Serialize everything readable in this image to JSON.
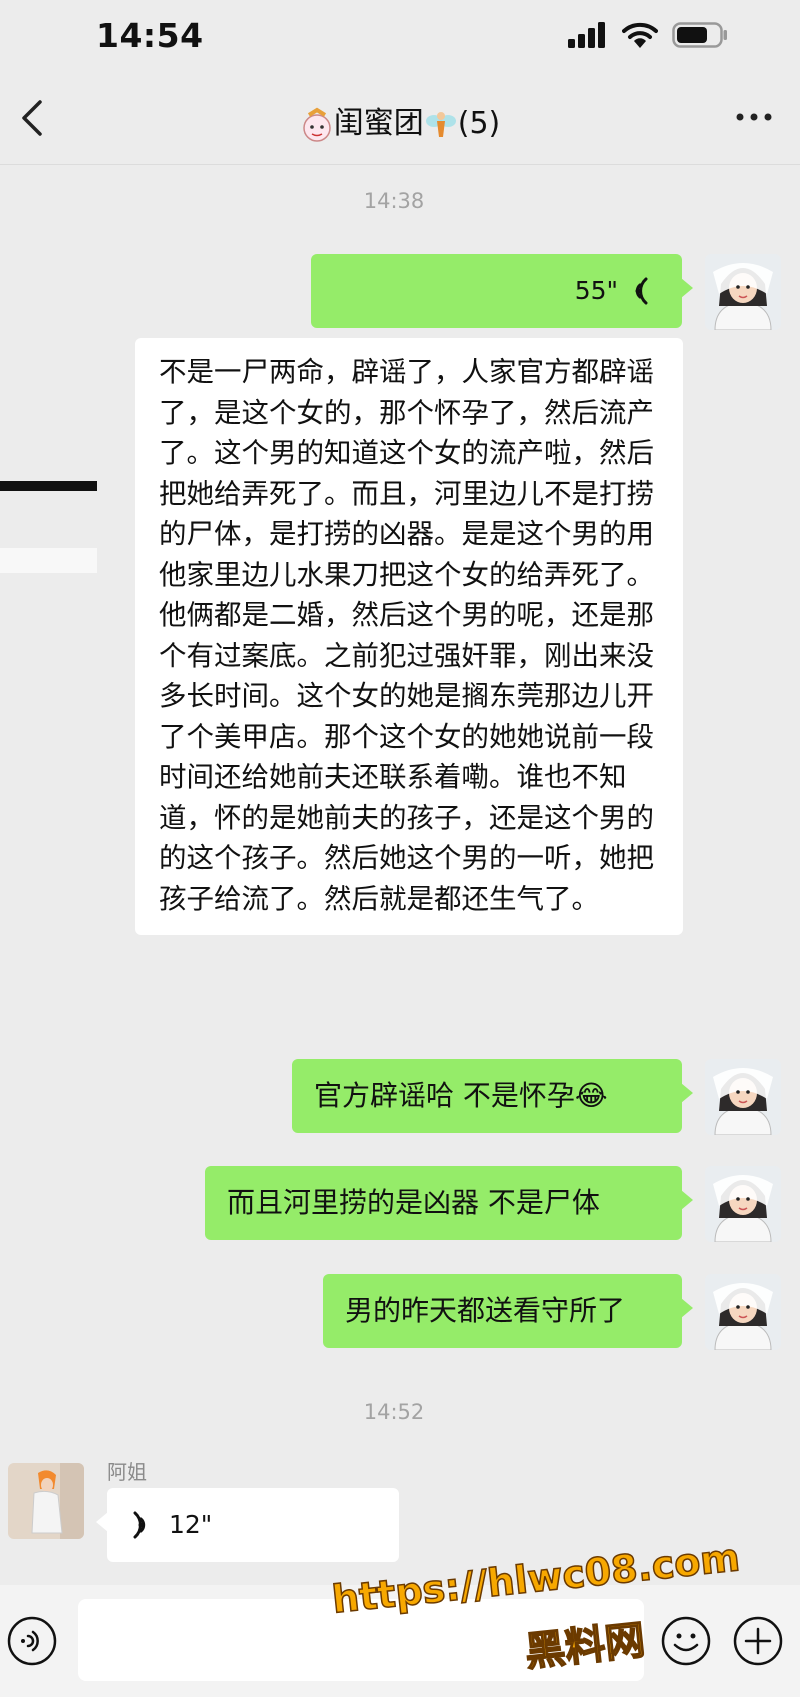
{
  "status_bar": {
    "time": "14:54"
  },
  "header": {
    "title": "闺蜜团",
    "member_count": "(5)"
  },
  "time_dividers": [
    "14:38",
    "14:52"
  ],
  "messages": {
    "voice_out": {
      "duration": "55\""
    },
    "long_text": "不是一尸两命，辟谣了，人家官方都辟谣了，是这个女的，那个怀孕了，然后流产了。这个男的知道这个女的流产啦，然后把她给弄死了。而且，河里边儿不是打捞的尸体，是打捞的凶器。是是这个男的用他家里边儿水果刀把这个女的给弄死了。他俩都是二婚，然后这个男的呢，还是那个有过案底。之前犯过强奸罪，刚出来没多长时间。这个女的她是搁东莞那边儿开了个美甲店。那个这个女的她她说前一段时间还给她前夫还联系着嘞。谁也不知道，怀的是她前夫的孩子，还是这个男的的这个孩子。然后她这个男的一听，她把孩子给流了。然后就是都还生气了。",
    "green_1": "官方辟谣哈  不是怀孕😂",
    "green_2": "而且河里捞的是凶器  不是尸体",
    "green_3": "男的昨天都送看守所了",
    "sender_name": "阿姐",
    "voice_in": {
      "duration": "12\""
    }
  },
  "watermark": {
    "url": "https://hlwc08.com",
    "site_name": "黑料网"
  },
  "icons": [
    "signal-icon",
    "wifi-icon",
    "battery-icon",
    "back-icon",
    "more-icon",
    "voice-wave-icon",
    "voice-mode-icon",
    "emoji-icon",
    "plus-icon"
  ],
  "colors": {
    "bubble_green": "#95ec69",
    "background": "#ececec",
    "watermark": "#f7a800"
  }
}
